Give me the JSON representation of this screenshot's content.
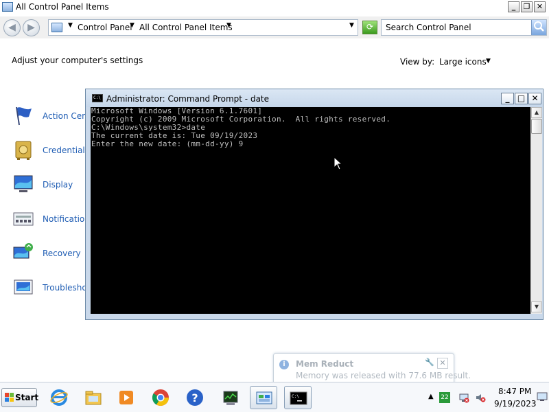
{
  "control_panel": {
    "title": "All Control Panel Items",
    "breadcrumb": [
      "Control Panel",
      "All Control Panel Items"
    ],
    "search_placeholder": "Search Control Panel",
    "heading": "Adjust your computer's settings",
    "view_by_label": "View by:",
    "view_by_value": "Large icons",
    "items": [
      {
        "label": "Action Cent",
        "icon": "flag-icon"
      },
      {
        "label": "Credential M",
        "icon": "vault-icon"
      },
      {
        "label": "Display",
        "icon": "monitor-icon"
      },
      {
        "label": "Notificatior",
        "icon": "notification-icons-icon"
      },
      {
        "label": "Recovery",
        "icon": "recovery-icon"
      },
      {
        "label": "Troublesho",
        "icon": "troubleshooting-icon"
      }
    ]
  },
  "cmd": {
    "title": "Administrator:  Command Prompt - date",
    "lines": [
      "Microsoft Windows [Version 6.1.7601]",
      "Copyright (c) 2009 Microsoft Corporation.  All rights reserved.",
      "",
      "C:\\Windows\\system32>date",
      "The current date is: Tue 09/19/2023",
      "Enter the new date: (mm-dd-yy) 9"
    ]
  },
  "notification": {
    "title": "Mem Reduct",
    "message": "Memory was released with 77.6 MB result."
  },
  "taskbar": {
    "start_label": "Start",
    "pinned": [
      "internet-explorer-icon",
      "file-explorer-icon",
      "media-player-icon",
      "chrome-icon",
      "help-icon",
      "task-manager-icon",
      "control-panel-icon",
      "command-prompt-icon"
    ],
    "tray_badge": "22",
    "time": "8:47 PM",
    "date": "9/19/2023"
  },
  "colors": {
    "link": "#1e5cb3",
    "console_bg": "#000000",
    "console_fg": "#c0c0c0",
    "tray_badge": "#2a9a3a"
  }
}
